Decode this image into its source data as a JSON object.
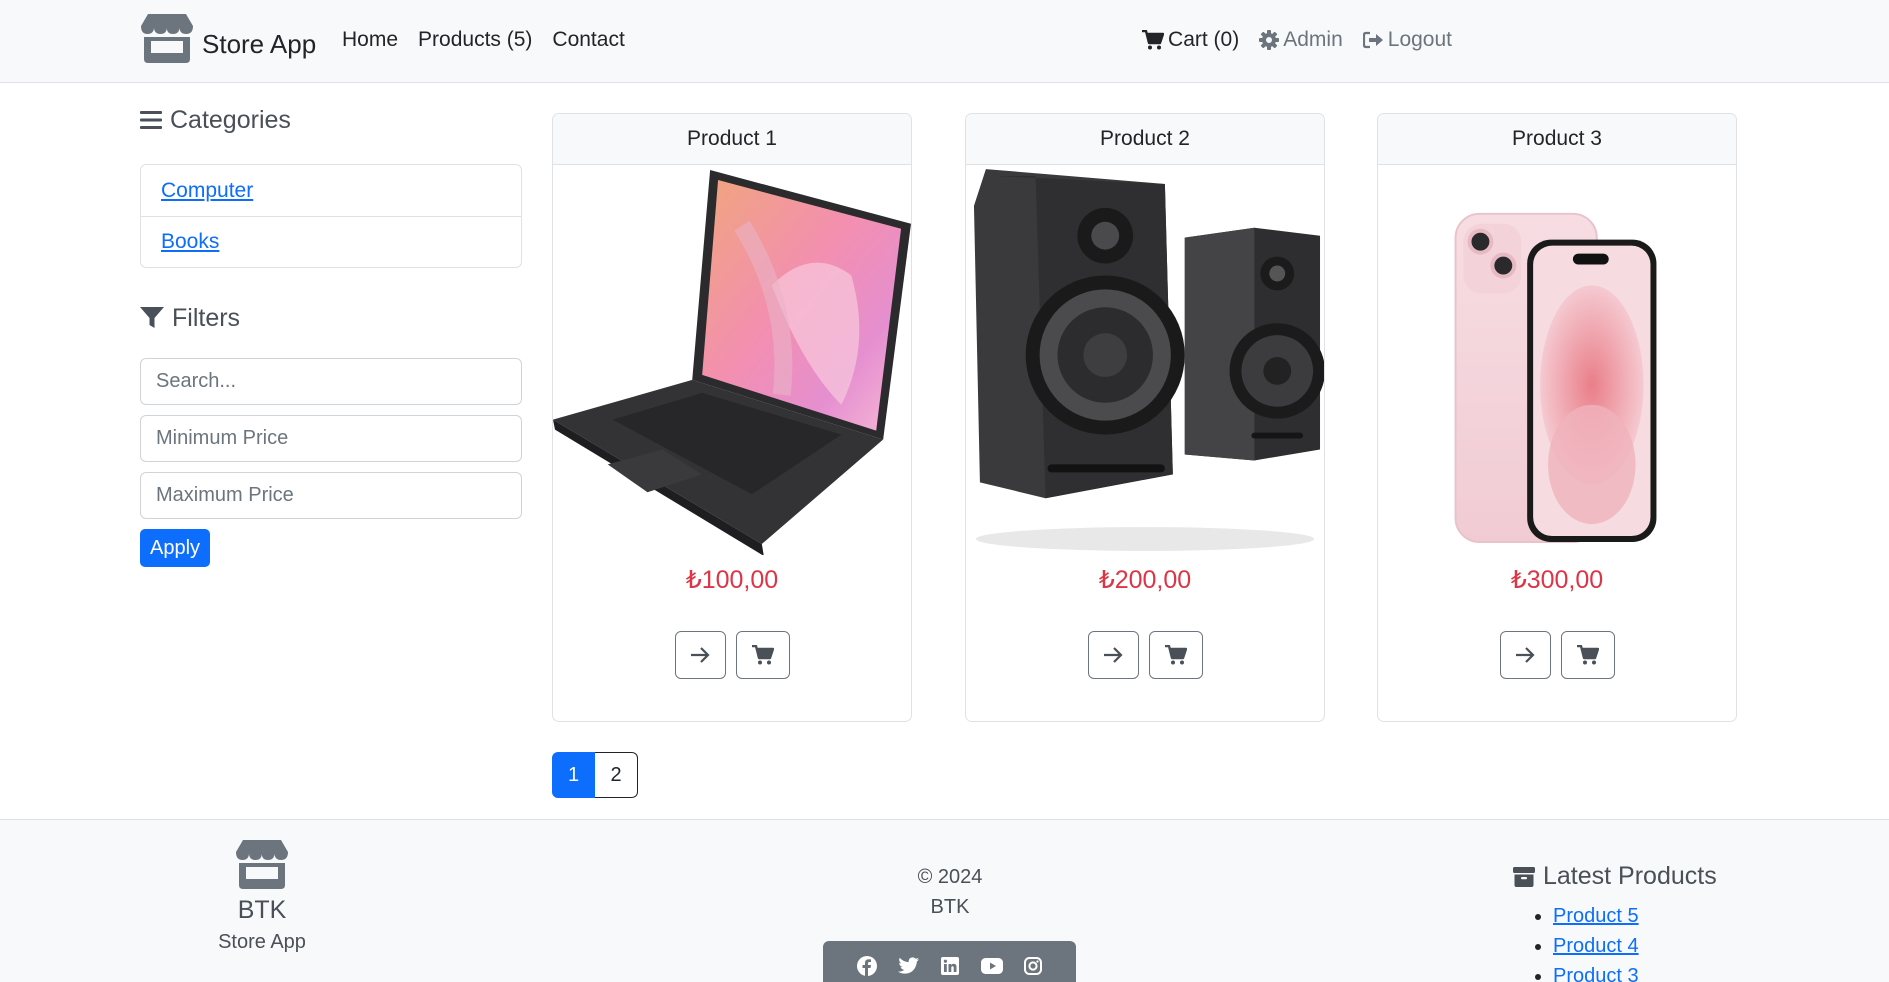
{
  "navbar": {
    "brand": "Store App",
    "links": [
      "Home",
      "Products (5)",
      "Contact"
    ],
    "cart_label": "Cart (0)",
    "admin_label": "Admin",
    "logout_label": "Logout",
    "icons": {
      "brand": "store-icon",
      "cart": "cart-icon",
      "admin": "gear-icon",
      "logout": "logout-icon"
    }
  },
  "sidebar": {
    "categories_heading": "Categories",
    "categories": [
      {
        "label": "Computer"
      },
      {
        "label": "Books"
      }
    ],
    "filters_heading": "Filters",
    "search_placeholder": "Search...",
    "min_price_placeholder": "Minimum Price",
    "max_price_placeholder": "Maximum Price",
    "apply_label": "Apply"
  },
  "products": [
    {
      "title": "Product 1",
      "price": "₺100,00",
      "image": "laptop-image"
    },
    {
      "title": "Product 2",
      "price": "₺200,00",
      "image": "speakers-image"
    },
    {
      "title": "Product 3",
      "price": "₺300,00",
      "image": "phone-image"
    }
  ],
  "pagination": {
    "pages": [
      "1",
      "2"
    ],
    "active": "1"
  },
  "footer": {
    "brand_name": "BTK",
    "brand_sub": "Store App",
    "copyright": "© 2024",
    "company": "BTK",
    "social_icons": [
      "facebook-icon",
      "twitter-icon",
      "linkedin-icon",
      "youtube-icon",
      "instagram-icon"
    ],
    "latest_heading": "Latest Products",
    "latest": [
      "Product 5",
      "Product 4",
      "Product 3"
    ]
  },
  "colors": {
    "primary": "#0d6efd",
    "price": "#dc3545",
    "muted": "#6c757d",
    "light": "#f8f9fa"
  }
}
